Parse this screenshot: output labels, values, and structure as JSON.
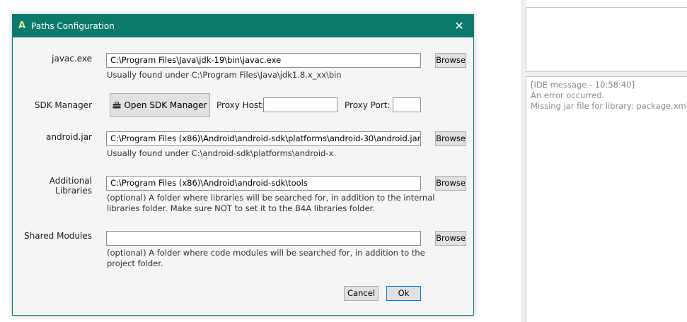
{
  "dialog": {
    "app_icon": "A",
    "title": "Paths Configuration",
    "close_glyph": "✕"
  },
  "javac": {
    "label": "javac.exe",
    "value": "C:\\Program Files\\Java\\jdk-19\\bin\\javac.exe",
    "hint": "Usually found under C:\\Program Files\\Java\\jdk1.8.x_xx\\bin",
    "browse_label": "Browse"
  },
  "sdk_manager": {
    "label": "SDK Manager",
    "button_label": "Open SDK Manager",
    "icon": "toolbox-icon",
    "proxy_host_label": "Proxy Host:",
    "proxy_host_value": "",
    "proxy_port_label": "Proxy Port:",
    "proxy_port_value": ""
  },
  "android_jar": {
    "label": "android.jar",
    "value": "C:\\Program Files (x86)\\Android\\android-sdk\\platforms\\android-30\\android.jar",
    "hint": "Usually found under C:\\android-sdk\\platforms\\android-x",
    "browse_label": "Browse"
  },
  "additional_libraries": {
    "label": "Additional Libraries",
    "value": "C:\\Program Files (x86)\\Android\\android-sdk\\tools",
    "hint_line1": "(optional) A folder where libraries will be searched for, in addition to the internal",
    "hint_line2": "libraries folder. Make sure NOT to set it to the B4A libraries folder.",
    "browse_label": "Browse"
  },
  "shared_modules": {
    "label": "Shared Modules",
    "value": "",
    "hint_line1": "(optional) A folder where code modules will be searched for, in addition to the",
    "hint_line2": "project folder.",
    "browse_label": "Browse"
  },
  "footer": {
    "cancel_label": "Cancel",
    "ok_label": "Ok"
  },
  "ide_log": {
    "line1": "[IDE message - 10:58:40]",
    "line2": "An error occurred.",
    "line3": "Missing jar file for library: package.xml"
  },
  "colors": {
    "accent": "#0b7a6c",
    "dialog_bg": "#f5f5f5",
    "log_text": "#8a8a8a"
  }
}
